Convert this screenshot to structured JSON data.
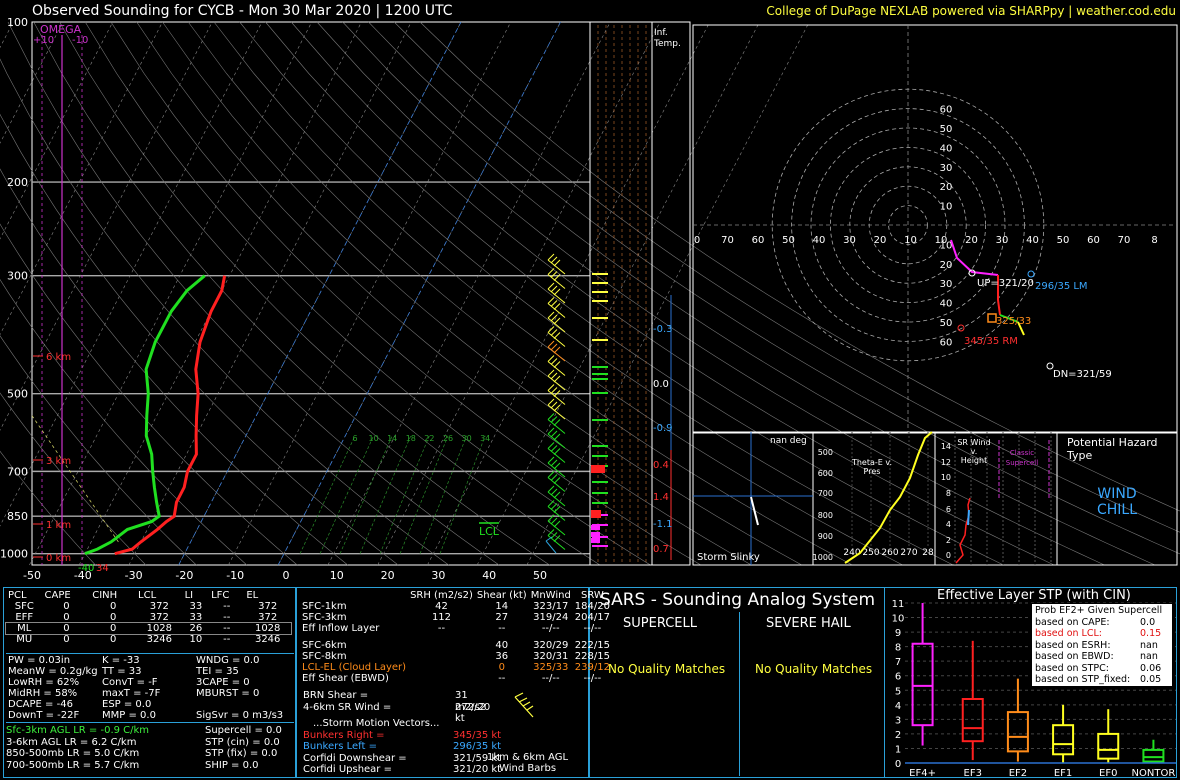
{
  "header": {
    "title": "Observed Sounding for CYCB  -  Mon 30 Mar 2020 | 1200 UTC",
    "credit": "College of DuPage NEXLAB powered via SHARPpy | weather.cod.edu"
  },
  "colors": {
    "temp": "#ff2020",
    "dewpoint": "#20e020",
    "grid": "#ffffff",
    "accent": "#2aa0d8",
    "omega": "#cc33cc",
    "header_credit": "#ffff40"
  },
  "skewt": {
    "pressure_labels": [
      "100",
      "200",
      "300",
      "500",
      "700",
      "850",
      "1000"
    ],
    "temp_labels": [
      "-50",
      "-40",
      "-30",
      "-20",
      "-10",
      "0",
      "10",
      "20",
      "30",
      "40",
      "50"
    ],
    "height_labels": [
      "6 km",
      "3 km",
      "1 km",
      "0 km"
    ],
    "omega_label": "OMEGA",
    "omega_ticks": [
      "+10",
      "-10"
    ],
    "lcl_label": "LCL",
    "sfc_labels": [
      "-40",
      "34"
    ],
    "mixing_labels": [
      "6",
      "10",
      "14",
      "18",
      "22",
      "26",
      "30",
      "34"
    ]
  },
  "chart_data": [
    {
      "type": "line",
      "title": "Observed Sounding for CYCB  -  Mon 30 Mar 2020 | 1200 UTC",
      "x_axis": "temperature (°C, skewed)",
      "y_axis": "pressure (mb, log)",
      "ylim": [
        1000,
        100
      ],
      "xlim": [
        -50,
        50
      ],
      "series": [
        {
          "name": "",
          "points": [
            [
              1000,
              -34
            ],
            [
              980,
              -31
            ],
            [
              950,
              -30
            ],
            [
              900,
              -28
            ],
            [
              870,
              -27
            ],
            [
              850,
              -26
            ],
            [
              800,
              -27
            ],
            [
              750,
              -27
            ],
            [
              700,
              -28
            ],
            [
              650,
              -28
            ],
            [
              600,
              -30
            ],
            [
              550,
              -32
            ],
            [
              500,
              -34
            ],
            [
              450,
              -37
            ],
            [
              400,
              -39
            ],
            [
              350,
              -40
            ],
            [
              320,
              -40
            ],
            [
              300,
              -41
            ]
          ]
        },
        {
          "name": "",
          "points": [
            [
              1000,
              -40
            ],
            [
              980,
              -38
            ],
            [
              950,
              -36
            ],
            [
              900,
              -34
            ],
            [
              870,
              -30
            ],
            [
              850,
              -29
            ],
            [
              800,
              -31
            ],
            [
              750,
              -33
            ],
            [
              700,
              -35
            ],
            [
              650,
              -37
            ],
            [
              600,
              -40
            ],
            [
              550,
              -42
            ],
            [
              500,
              -44
            ],
            [
              450,
              -47
            ],
            [
              400,
              -48
            ],
            [
              350,
              -48
            ],
            [
              320,
              -47
            ],
            [
              300,
              -45
            ]
          ]
        }
      ]
    },
    {
      "type": "scatter",
      "title": "",
      "rings": [
        "10",
        "20",
        "30",
        "40",
        "50",
        "60"
      ],
      "x_ticks": [
        "0",
        "70",
        "60",
        "50",
        "40",
        "30",
        "20",
        "10",
        "10",
        "20",
        "30",
        "40",
        "50",
        "60",
        "70",
        "8"
      ],
      "labels": [
        {
          "text": "UP=321/20",
          "color": "#ffffff"
        },
        {
          "text": "296/35 LM",
          "color": "#3aa8ff"
        },
        {
          "text": "325/33",
          "color": "#ff8c1a"
        },
        {
          "text": "345/35 RM",
          "color": "#ff3030"
        },
        {
          "text": "DN=321/59",
          "color": "#ffffff"
        }
      ]
    },
    {
      "type": "bar",
      "title": "Effective Layer STP (with CIN)",
      "categories": [
        "EF4+",
        "EF3",
        "EF2",
        "EF1",
        "EF0",
        "NONTOR"
      ],
      "ylim": [
        0,
        11
      ],
      "y_ticks": [
        "0",
        "1",
        "2",
        "3",
        "4",
        "5",
        "6",
        "7",
        "8",
        "9",
        "10",
        "11"
      ],
      "boxes": [
        {
          "cat": "EF4+",
          "lo": 1.2,
          "q1": 2.6,
          "med": 5.3,
          "q3": 8.2,
          "hi": 11.0,
          "color": "#ff20ff"
        },
        {
          "cat": "EF3",
          "lo": 0.2,
          "q1": 1.5,
          "med": 2.4,
          "q3": 4.4,
          "hi": 8.4,
          "color": "#ff2020"
        },
        {
          "cat": "EF2",
          "lo": 0.1,
          "q1": 0.8,
          "med": 1.8,
          "q3": 3.5,
          "hi": 5.8,
          "color": "#ff8c1a"
        },
        {
          "cat": "EF1",
          "lo": 0.0,
          "q1": 0.6,
          "med": 1.3,
          "q3": 2.6,
          "hi": 4.0,
          "color": "#ffff20"
        },
        {
          "cat": "EF0",
          "lo": 0.0,
          "q1": 0.3,
          "med": 0.9,
          "q3": 2.0,
          "hi": 3.7,
          "color": "#ffff20"
        },
        {
          "cat": "NONTOR",
          "lo": 0.0,
          "q1": 0.1,
          "med": 0.4,
          "q3": 0.9,
          "hi": 1.6,
          "color": "#20e020"
        }
      ]
    }
  ],
  "right_column": {
    "inf_label_1": "Inf.",
    "inf_label_2": "Temp.",
    "values": [
      "-0.3",
      "0.0",
      "-0.9",
      "0.4",
      "1.4",
      "-1.1",
      "0.7"
    ]
  },
  "small_panels": {
    "slinky_units": "nan deg",
    "slinky_label": "Storm Slinky",
    "thetae_title": "Theta-E v. Pres",
    "thetae_y": [
      "500",
      "600",
      "700",
      "800",
      "900",
      "1000"
    ],
    "thetae_x": [
      "240",
      "250",
      "260",
      "270",
      "28"
    ],
    "srwind_title": "SR Wind v. Height",
    "srwind_y": [
      "14",
      "12",
      "10",
      "8",
      "6",
      "4",
      "2",
      "0"
    ],
    "classic": "Classic Supercell",
    "hazard_title": "Potential Hazard Type",
    "hazard_value_1": "WIND",
    "hazard_value_2": "CHILL"
  },
  "parcels": {
    "headers": [
      "PCL",
      "CAPE",
      "CINH",
      "LCL",
      "LI",
      "LFC",
      "EL"
    ],
    "rows": [
      [
        "SFC",
        "0",
        "0",
        "372",
        "33",
        "--",
        "372"
      ],
      [
        "EFF",
        "0",
        "0",
        "372",
        "33",
        "--",
        "372"
      ],
      [
        "ML",
        "0",
        "0",
        "1028",
        "26",
        "--",
        "1028"
      ],
      [
        "MU",
        "0",
        "0",
        "3246",
        "10",
        "--",
        "3246"
      ]
    ]
  },
  "indices": [
    [
      "PW = 0.03in",
      "K = -33",
      "WNDG = 0.0"
    ],
    [
      "MeanW = 0.2g/kg",
      "TT = 33",
      "TEI = 35"
    ],
    [
      "LowRH = 62%",
      "ConvT = -F",
      "3CAPE = 0"
    ],
    [
      "MidRH = 58%",
      "maxT = -7F",
      "MBURST = 0"
    ],
    [
      "DCAPE = -46",
      "ESP = 0.0",
      ""
    ],
    [
      "DownT = -22F",
      "MMP = 0.0",
      "SigSvr = 0 m3/s3"
    ]
  ],
  "lapse_rates": [
    "Sfc-3km AGL LR = -0.9 C/km",
    "3-6km AGL LR = 6.2 C/km",
    "850-500mb LR = 5.0 C/km",
    "700-500mb LR = 5.7 C/km"
  ],
  "composites": [
    "Supercell = 0.0",
    "STP (cin) = 0.0",
    "STP (fix) = 0.0",
    "SHIP = 0.0"
  ],
  "kinematics": {
    "headers": [
      "SRH (m2/s2)",
      "Shear (kt)",
      "MnWind",
      "SRW"
    ],
    "rows": [
      [
        "SFC-1km",
        "42",
        "14",
        "323/17",
        "184/20"
      ],
      [
        "SFC-3km",
        "112",
        "27",
        "319/24",
        "204/17"
      ],
      [
        "Eff Inflow Layer",
        "--",
        "--",
        "--/--",
        "--/--"
      ],
      [
        "",
        "",
        "",
        "",
        ""
      ],
      [
        "SFC-6km",
        "40",
        "320/29",
        "222/15",
        ""
      ],
      [
        "SFC-8km",
        "36",
        "320/31",
        "228/15",
        ""
      ],
      [
        "LCL-EL (Cloud Layer)",
        "0",
        "325/33",
        "239/12",
        ""
      ],
      [
        "Eff Shear (EBWD)",
        "--",
        "--/--",
        "--/--",
        ""
      ]
    ],
    "brn_label": "BRN Shear =",
    "brn_value": "31 m2/s2",
    "sr_label": "4-6km SR Wind =",
    "sr_value": "272/20 kt",
    "storm_title": "...Storm Motion Vectors...",
    "storm_rows": [
      [
        "Bunkers Right =",
        "345/35 kt"
      ],
      [
        "Bunkers Left =",
        "296/35 kt"
      ],
      [
        "Corfidi Downshear =",
        "321/59 kt"
      ],
      [
        "Corfidi Upshear =",
        "321/20 kt"
      ]
    ],
    "barb_label_1": "1km & 6km AGL",
    "barb_label_2": "Wind Barbs"
  },
  "sars": {
    "title": "SARS - Sounding Analog System",
    "supercell": "SUPERCELL",
    "hail": "SEVERE HAIL",
    "supercell_value": "No Quality Matches",
    "hail_value": "No Quality Matches"
  },
  "stp": {
    "prob_title": "Prob EF2+ Given Supercell",
    "prob_rows": [
      [
        "based on CAPE:",
        "0.0"
      ],
      [
        "based on LCL:",
        "0.15"
      ],
      [
        "based on ESRH:",
        "nan"
      ],
      [
        "based on EBWD:",
        "nan"
      ],
      [
        "based on STPC:",
        "0.06"
      ],
      [
        "based on STP_fixed:",
        "0.05"
      ]
    ]
  }
}
